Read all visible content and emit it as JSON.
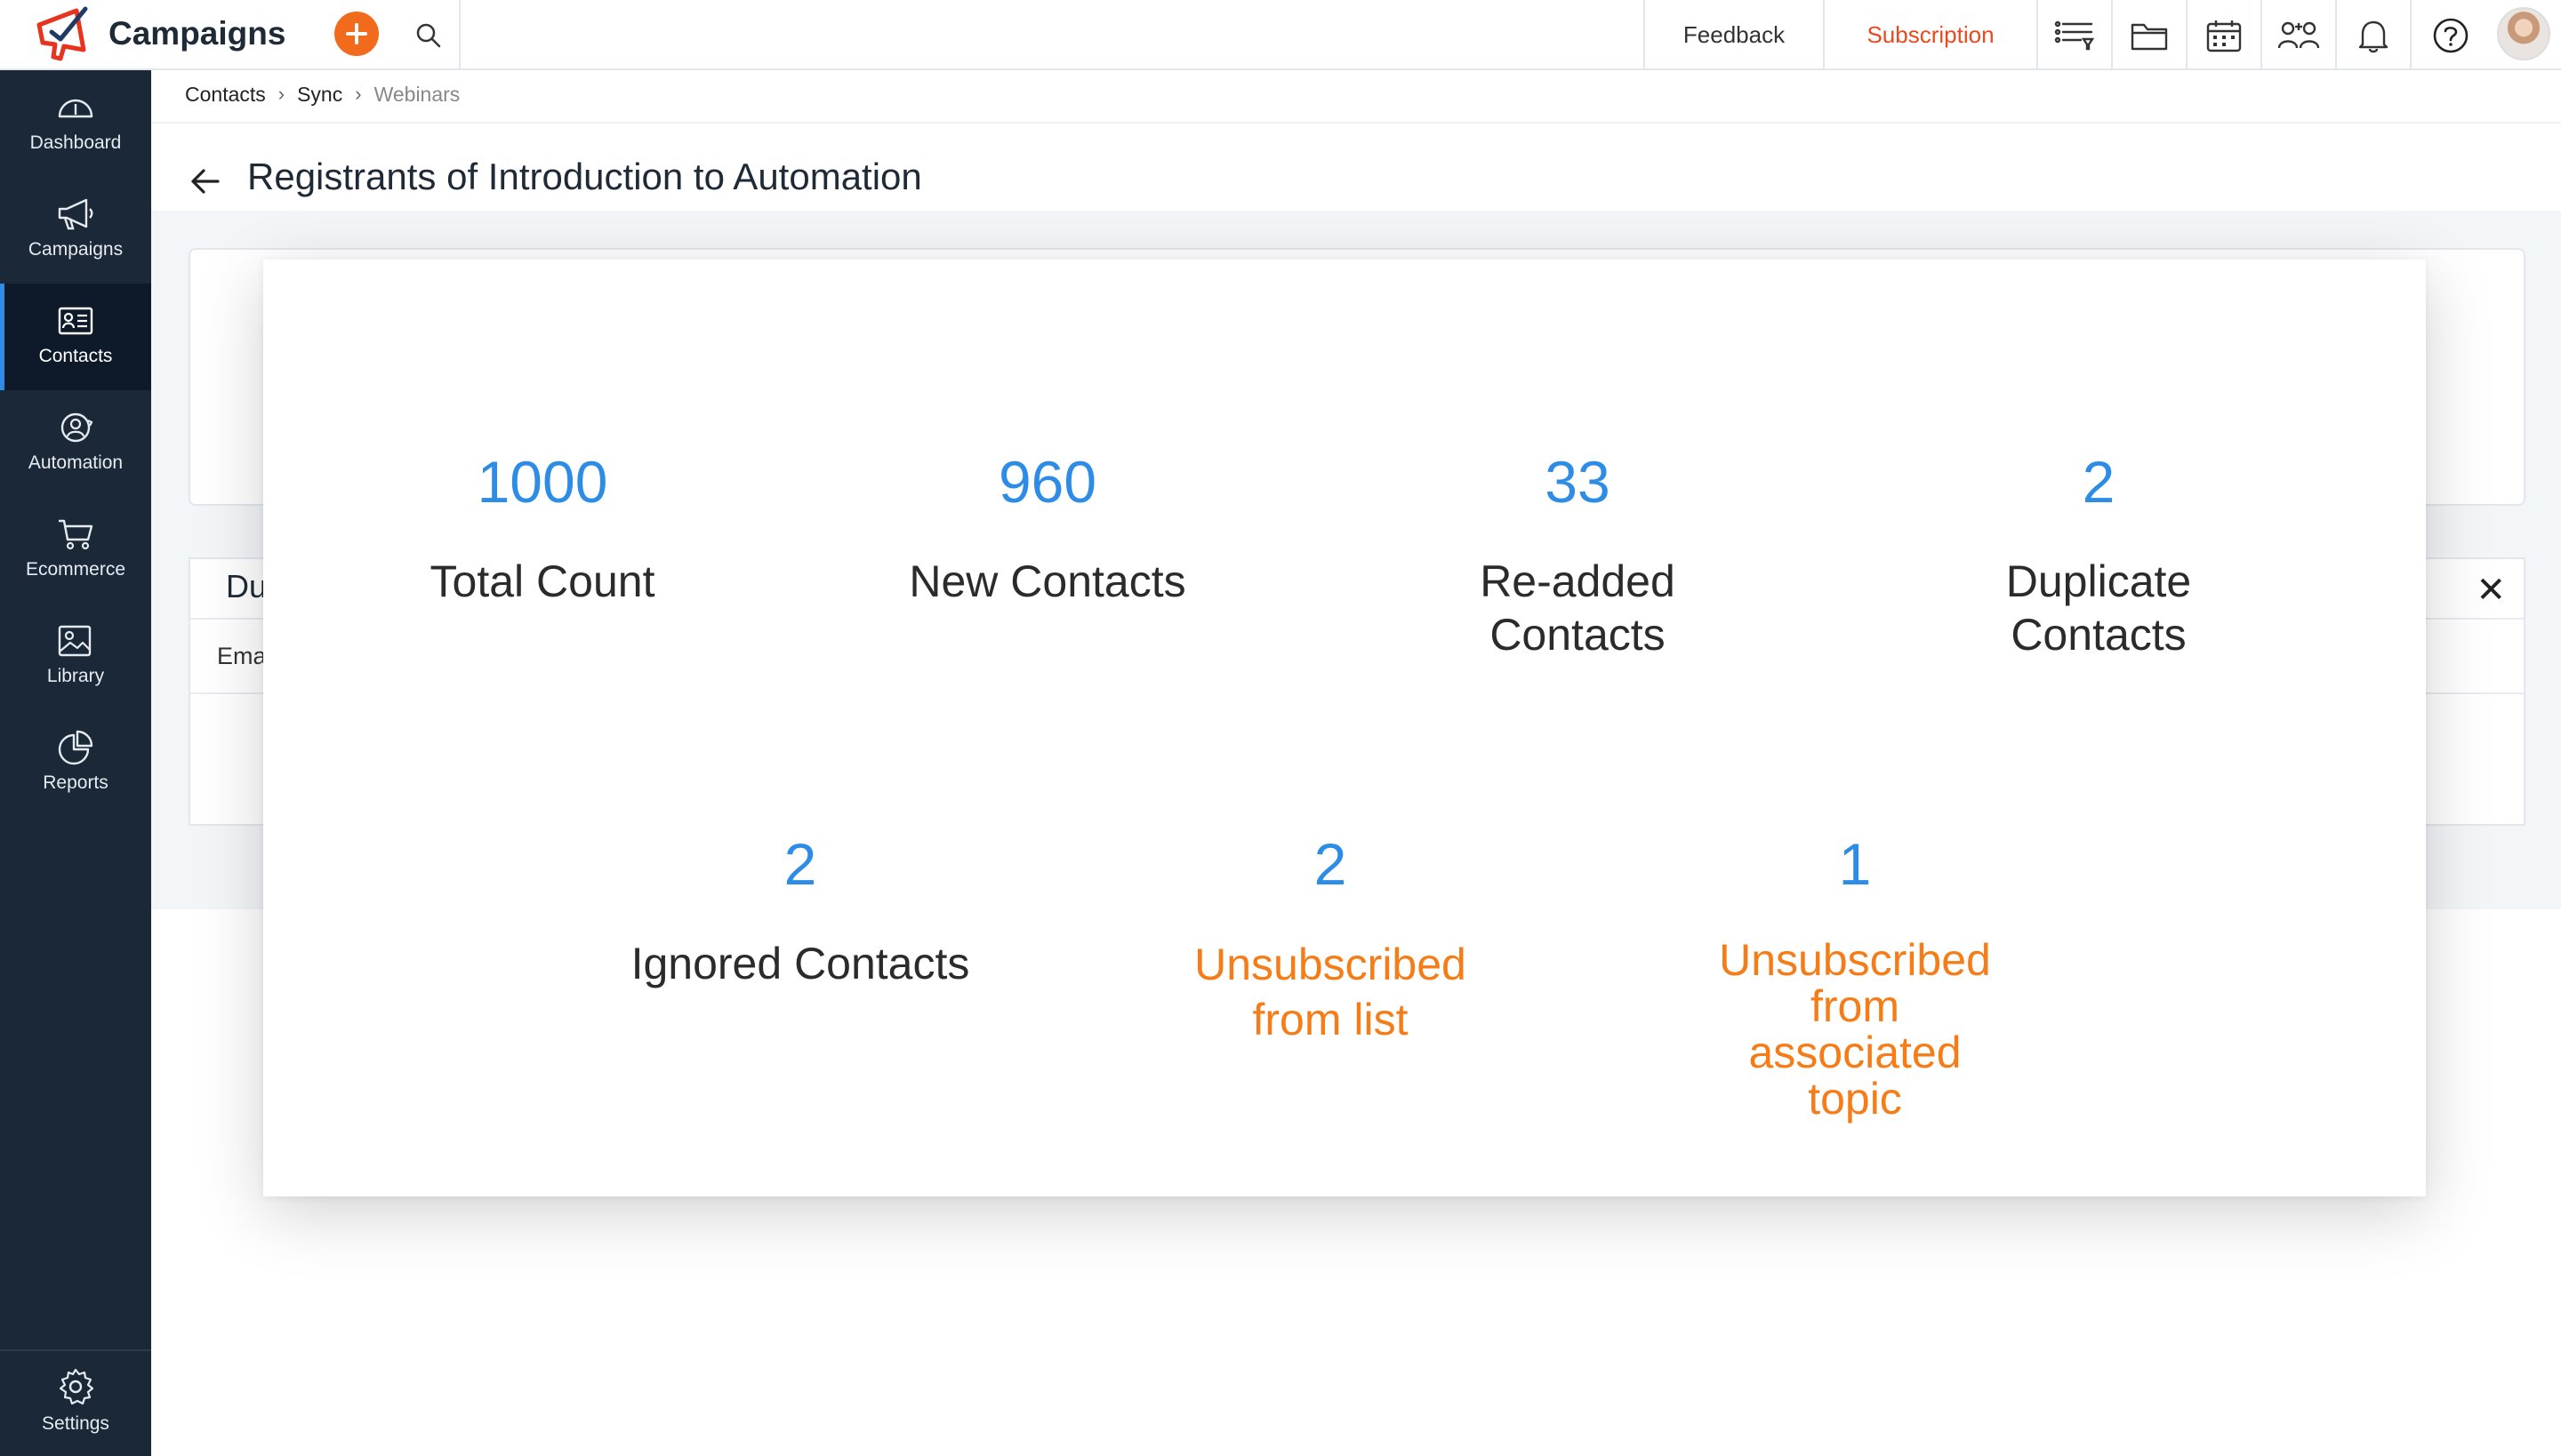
{
  "app": {
    "name": "Campaigns"
  },
  "header": {
    "feedback_label": "Feedback",
    "subscription_label": "Subscription",
    "accent_color": "#f26b1d"
  },
  "sidebar": {
    "items": [
      {
        "label": "Dashboard",
        "icon": "gauge-icon"
      },
      {
        "label": "Campaigns",
        "icon": "megaphone-icon"
      },
      {
        "label": "Contacts",
        "icon": "contact-card-icon",
        "active": true
      },
      {
        "label": "Automation",
        "icon": "automation-icon"
      },
      {
        "label": "Ecommerce",
        "icon": "cart-icon"
      },
      {
        "label": "Library",
        "icon": "image-icon"
      },
      {
        "label": "Reports",
        "icon": "pie-chart-icon"
      }
    ],
    "settings_label": "Settings"
  },
  "breadcrumb": [
    "Contacts",
    "Sync",
    "Webinars"
  ],
  "page": {
    "title": "Registrants of  Introduction to Automation"
  },
  "duplicates": {
    "title": "Dupli",
    "column": "Ema"
  },
  "modal": {
    "stats": [
      {
        "value": "1000",
        "label": "Total Count"
      },
      {
        "value": "960",
        "label": "New Contacts"
      },
      {
        "value": "33",
        "label": "Re-added Contacts"
      },
      {
        "value": "2",
        "label": "Duplicate Contacts"
      },
      {
        "value": "2",
        "label": "Ignored Contacts"
      },
      {
        "value": "2",
        "label": "Unsubscribed from list"
      },
      {
        "value": "1",
        "label": "Unsubscribed from associated topic"
      }
    ],
    "number_color": "#2d8ce6",
    "warning_color": "#f57c17"
  }
}
